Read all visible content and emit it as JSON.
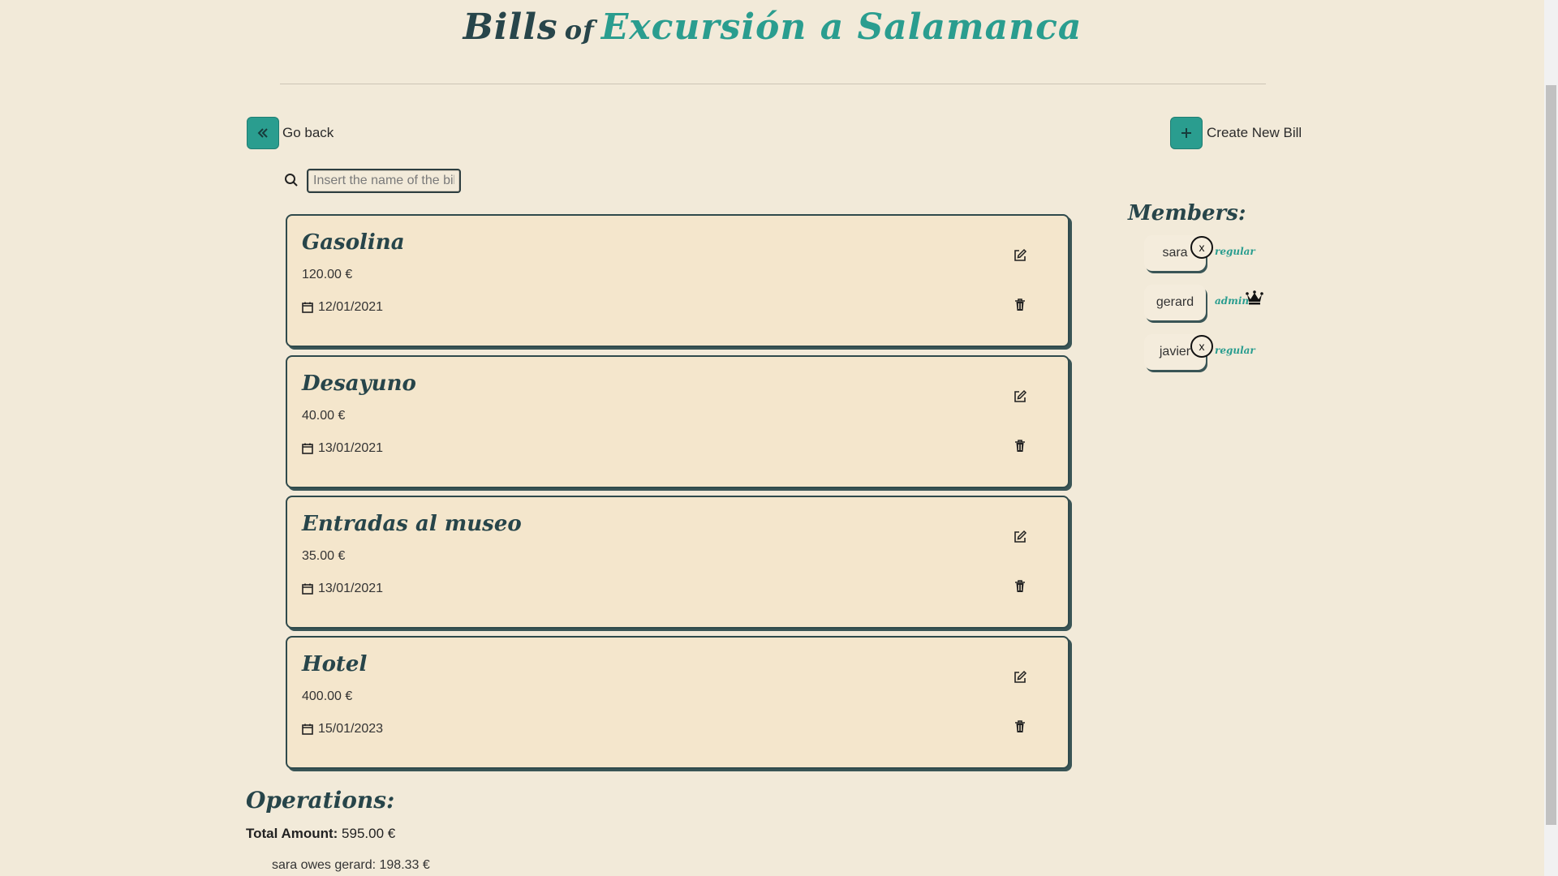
{
  "header": {
    "title_word": "Bills",
    "title_of": "of",
    "group_name": "Excursión a Salamanca"
  },
  "nav": {
    "back_label": "Go back",
    "create_label": "Create New Bill"
  },
  "search": {
    "placeholder": "Insert the name of the bill",
    "value": ""
  },
  "currency_symbol": "€",
  "bills": [
    {
      "name": "Gasolina",
      "amount": "120.00",
      "date": "12/01/2021"
    },
    {
      "name": "Desayuno",
      "amount": "40.00",
      "date": "13/01/2021"
    },
    {
      "name": "Entradas al museo",
      "amount": "35.00",
      "date": "13/01/2021"
    },
    {
      "name": "Hotel",
      "amount": "400.00",
      "date": "15/01/2023"
    }
  ],
  "members": {
    "title": "Members:",
    "list": [
      {
        "name": "sara",
        "role": "regular",
        "remove_label": "x"
      },
      {
        "name": "gerard",
        "role": "admin"
      },
      {
        "name": "javier",
        "role": "regular",
        "remove_label": "x"
      }
    ]
  },
  "operations": {
    "title": "Operations:",
    "total_label": "Total Amount:",
    "total_value": "595.00 €",
    "debts": [
      "sara owes gerard: 198.33 €"
    ]
  },
  "colors": {
    "background": "#f2ead9",
    "accent": "#2a9d8f",
    "card": "#f4e6cc",
    "heading": "#27454a"
  }
}
